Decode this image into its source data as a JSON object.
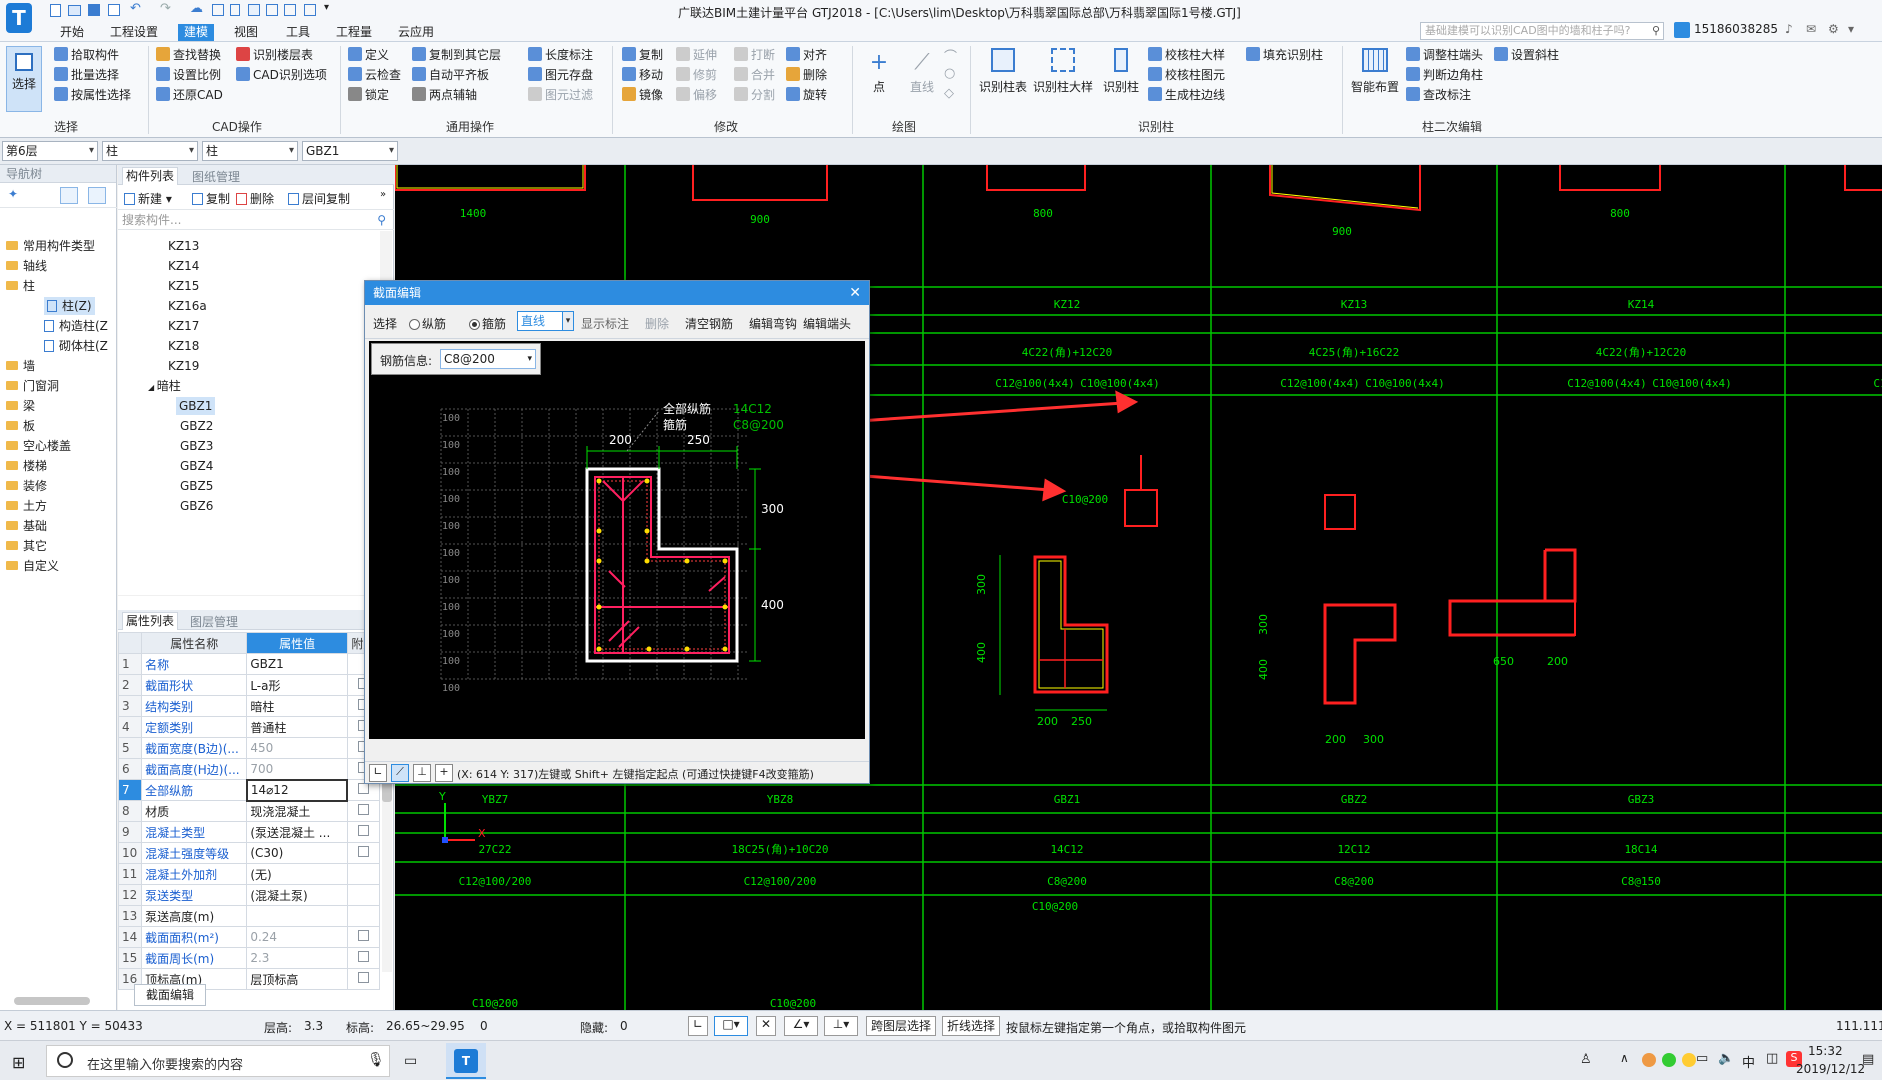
{
  "window": {
    "title": "广联达BIM土建计量平台 GTJ2018 - [C:\\Users\\lim\\Desktop\\万科翡翠国际总部\\万科翡翠国际1号楼.GTJ]",
    "search_placeholder": "基础建模可以识别CAD图中的墙和柱子吗?",
    "user": "15186038285"
  },
  "menu": [
    "开始",
    "工程设置",
    "建模",
    "视图",
    "工具",
    "工程量",
    "云应用"
  ],
  "active_menu": "建模",
  "ribbon": {
    "select": {
      "label": "选择",
      "group": "选择",
      "items": [
        "拾取构件",
        "批量选择",
        "按属性选择"
      ]
    },
    "cad": {
      "group": "CAD操作",
      "items": [
        "查找替换",
        "设置比例",
        "还原CAD",
        "识别楼层表",
        "CAD识别选项"
      ]
    },
    "general": {
      "group": "通用操作",
      "items": [
        "定义",
        "云检查",
        "锁定",
        "复制到其它层",
        "自动平齐板",
        "两点辅轴",
        "长度标注",
        "图元存盘",
        "图元过滤"
      ]
    },
    "modify": {
      "group": "修改",
      "items": [
        "复制",
        "移动",
        "镜像",
        "延伸",
        "修剪",
        "偏移",
        "打断",
        "合并",
        "分割",
        "对齐",
        "删除",
        "旋转"
      ]
    },
    "draw": {
      "group": "绘图",
      "items": [
        "点",
        "直线"
      ]
    },
    "recognize": {
      "group": "识别柱",
      "items": [
        "识别柱表",
        "识别柱大样",
        "识别柱",
        "校核柱大样",
        "校核柱图元",
        "生成柱边线",
        "填充识别柱"
      ]
    },
    "edit2": {
      "group": "柱二次编辑",
      "items": [
        "智能布置",
        "调整柱端头",
        "判断边角柱",
        "查改标注",
        "设置斜柱"
      ]
    }
  },
  "selectors": [
    "第6层",
    "柱",
    "柱",
    "GBZ1"
  ],
  "nav": {
    "title": "导航树",
    "items": [
      "常用构件类型",
      "轴线",
      "柱",
      "柱(Z)",
      "构造柱(Z",
      "砌体柱(Z",
      "墙",
      "门窗洞",
      "梁",
      "板",
      "空心楼盖",
      "楼梯",
      "装修",
      "土方",
      "基础",
      "其它",
      "自定义"
    ]
  },
  "component_list": {
    "tabs": [
      "构件列表",
      "图纸管理"
    ],
    "toolbar": [
      "新建",
      "复制",
      "删除",
      "层间复制"
    ],
    "search_placeholder": "搜索构件...",
    "items": [
      "KZ13",
      "KZ14",
      "KZ15",
      "KZ16a",
      "KZ17",
      "KZ18",
      "KZ19",
      "暗柱",
      "GBZ1",
      "GBZ2",
      "GBZ3",
      "GBZ4",
      "GBZ5",
      "GBZ6"
    ],
    "selected": "GBZ1"
  },
  "properties": {
    "tabs": [
      "属性列表",
      "图层管理"
    ],
    "headers": [
      "属性名称",
      "属性值",
      "附加"
    ],
    "rows": [
      {
        "n": "1",
        "name": "名称",
        "value": "GBZ1",
        "chk": false
      },
      {
        "n": "2",
        "name": "截面形状",
        "value": "L-a形",
        "chk": true
      },
      {
        "n": "3",
        "name": "结构类别",
        "value": "暗柱",
        "chk": true
      },
      {
        "n": "4",
        "name": "定额类别",
        "value": "普通柱",
        "chk": true
      },
      {
        "n": "5",
        "name": "截面宽度(B边)(...",
        "value": "450",
        "chk": true
      },
      {
        "n": "6",
        "name": "截面高度(H边)(...",
        "value": "700",
        "chk": true
      },
      {
        "n": "7",
        "name": "全部纵筋",
        "value": "14⌀12",
        "chk": true
      },
      {
        "n": "8",
        "name": "材质",
        "value": "现浇混凝土",
        "chk": true
      },
      {
        "n": "9",
        "name": "混凝土类型",
        "value": "(泵送混凝土 ...",
        "chk": true
      },
      {
        "n": "10",
        "name": "混凝土强度等级",
        "value": "(C30)",
        "chk": true
      },
      {
        "n": "11",
        "name": "混凝土外加剂",
        "value": "(无)",
        "chk": false
      },
      {
        "n": "12",
        "name": "泵送类型",
        "value": "(混凝土泵)",
        "chk": false
      },
      {
        "n": "13",
        "name": "泵送高度(m)",
        "value": "",
        "chk": false
      },
      {
        "n": "14",
        "name": "截面面积(m²)",
        "value": "0.24",
        "chk": true
      },
      {
        "n": "15",
        "name": "截面周长(m)",
        "value": "2.3",
        "chk": true
      },
      {
        "n": "16",
        "name": "顶标高(m)",
        "value": "层顶标高",
        "chk": true
      }
    ],
    "bottom_button": "截面编辑"
  },
  "dialog": {
    "title": "截面编辑",
    "toolbar": [
      "选择",
      "纵筋",
      "箍筋",
      "直线",
      "显示标注",
      "删除",
      "清空钢筋",
      "编辑弯钩",
      "编辑端头"
    ],
    "rebar_info_label": "钢筋信息:",
    "rebar_info_value": "C8@200",
    "legend_all": "全部纵筋",
    "legend_all_val": "14C12",
    "legend_stirrup": "箍筋",
    "legend_stirrup_val": "C8@200",
    "dim_top_1": "200",
    "dim_top_2": "250",
    "dim_right_1": "300",
    "dim_right_2": "400",
    "grid_labels": [
      "100",
      "100",
      "100",
      "100",
      "100",
      "100",
      "100",
      "100",
      "100",
      "100",
      "100"
    ],
    "status": "(X: 614 Y: 317)左键或 Shift+ 左键指定起点 (可通过快捷键F4改变箍筋)"
  },
  "canvas": {
    "top_dims": [
      "1400",
      "900",
      "800",
      "900",
      "800"
    ],
    "col_headers": [
      "KZ12",
      "KZ13",
      "KZ14"
    ],
    "col_section": [
      "4C22(角)+12C20",
      "4C25(角)+16C22",
      "4C22(角)+12C20"
    ],
    "col_stirrups": [
      "C12@100(4x4)",
      "C10@100(4x4)",
      "C12@100(4x4)",
      "C10@100(4x4)",
      "C12@100(4x4)",
      "C10@100(4x4)"
    ],
    "bottom_headers": [
      "YBZ7",
      "YBZ8",
      "GBZ1",
      "GBZ2",
      "GBZ3"
    ],
    "bottom_bars": [
      "27C22",
      "18C25(角)+10C20",
      "14C12",
      "12C12",
      "18C14"
    ],
    "bottom_stirrups": [
      "C12@100/200",
      "C12@100/200",
      "C8@200",
      "C8@200",
      "C8@150"
    ],
    "detail_dims": [
      "300",
      "400",
      "200",
      "250",
      "200",
      "300",
      "650",
      "200",
      "300",
      "400",
      "300"
    ],
    "partial_label": "C10@200"
  },
  "status": {
    "coords": "X = 511801 Y = 50433",
    "floor_h_label": "层高:",
    "floor_h": "3.3",
    "elev_label": "标高:",
    "elev": "26.65~29.95",
    "zero": "0",
    "hidden_label": "隐藏:",
    "hidden": "0",
    "btn1": "跨图层选择",
    "btn2": "折线选择",
    "hint": "按鼠标左键指定第一个角点，或拾取构件图元",
    "right": "111.111"
  },
  "taskbar": {
    "search": "在这里输入你要搜索的内容",
    "time": "15:32",
    "date": "2019/12/12",
    "ime": "中"
  },
  "colors": {
    "accent": "#2d8ce0",
    "canvas": "#000000",
    "grid": "#00c800",
    "column": "#ff2020",
    "arrow": "#ff3030",
    "white_outline": "#ffffff"
  }
}
